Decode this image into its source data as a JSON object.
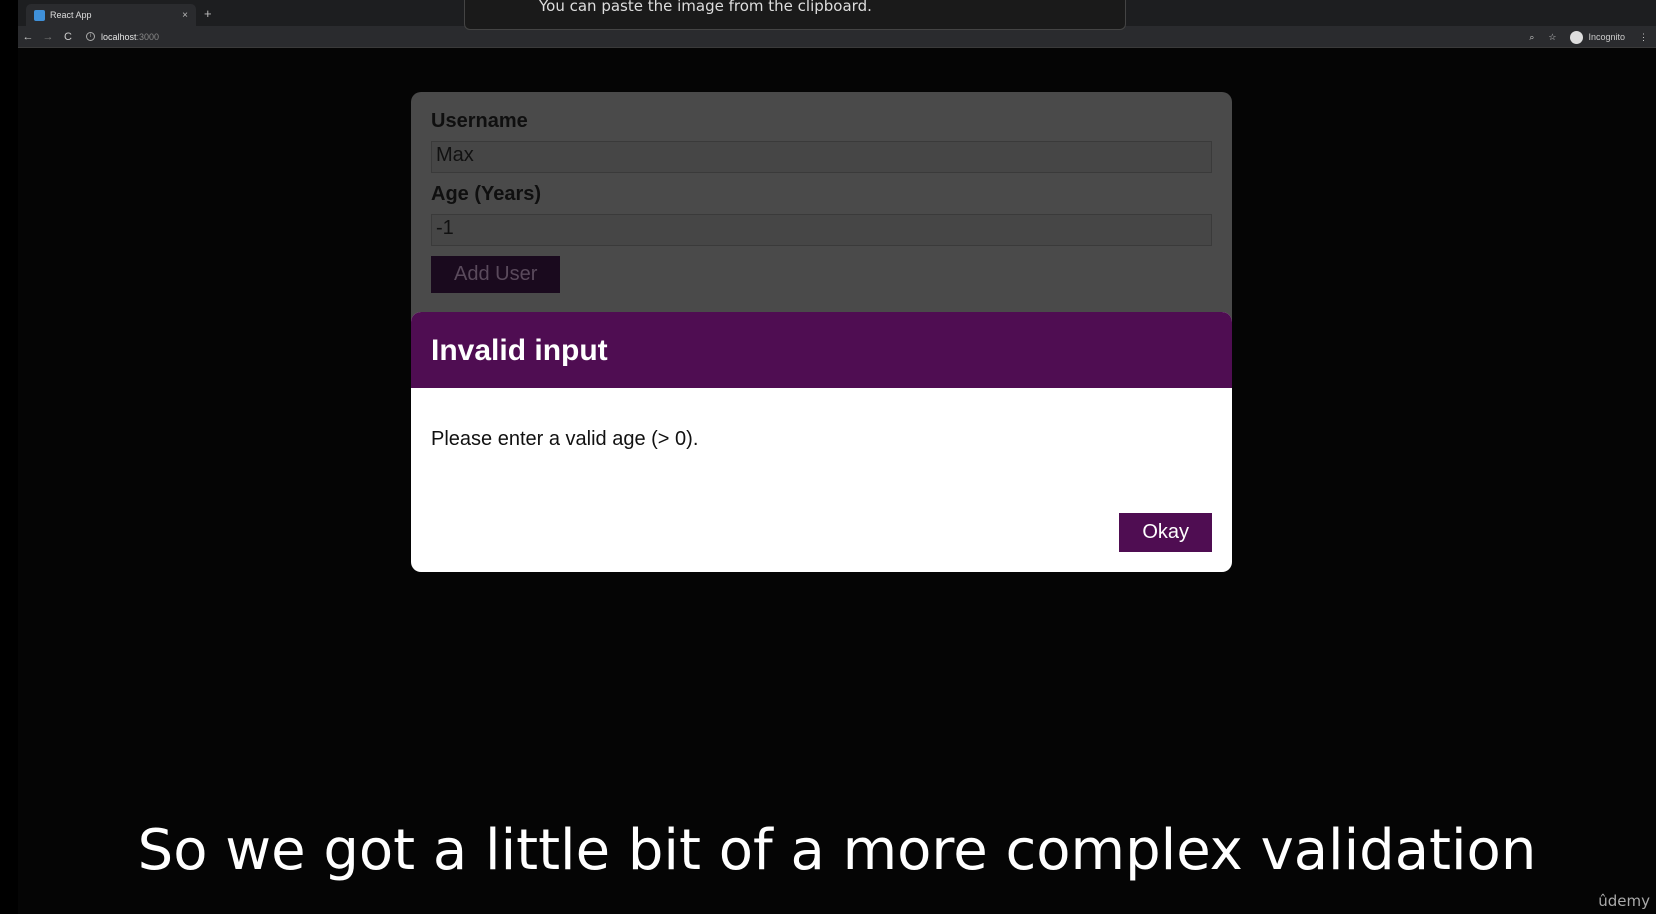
{
  "browser": {
    "tab_title": "React App",
    "tab_close": "×",
    "new_tab": "+",
    "back": "←",
    "forward": "→",
    "reload": "C",
    "url_host": "localhost",
    "url_port": ":3000",
    "zoom_icon": "⌕",
    "star_icon": "☆",
    "profile_label": "Incognito",
    "menu_icon": "⋮"
  },
  "tooltip": {
    "text": "You can paste the image from the clipboard."
  },
  "form": {
    "username_label": "Username",
    "username_value": "Max",
    "age_label": "Age (Years)",
    "age_value": "-1",
    "add_button": "Add User"
  },
  "modal": {
    "title": "Invalid input",
    "message": "Please enter a valid age (> 0).",
    "okay_button": "Okay"
  },
  "caption": {
    "text": "So we got a little bit of a more complex validation",
    "brand": "ûdemy"
  },
  "colors": {
    "modal_header": "#4f0d52",
    "button": "#4f0d52",
    "backdrop": "#050505"
  }
}
